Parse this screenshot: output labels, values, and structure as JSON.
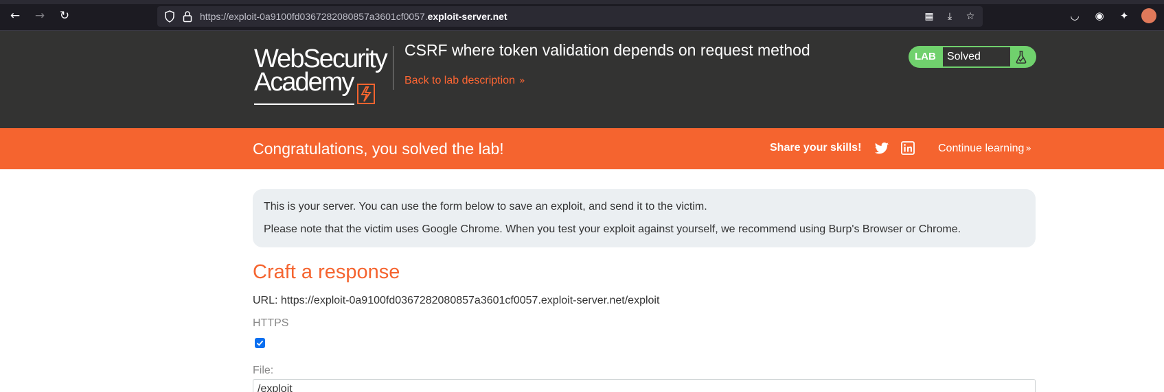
{
  "browser": {
    "url_prefix": "https://exploit-0a9100fd0367282080857a3601cf0057.",
    "url_domain": "exploit-server.net"
  },
  "header": {
    "logo_line1": "WebSecurity",
    "logo_line2": "Academy",
    "lab_title": "CSRF where token validation depends on request method",
    "back_link": "Back to lab description",
    "lab_badge": "LAB",
    "lab_status": "Solved"
  },
  "banner": {
    "congrats": "Congratulations, you solved the lab!",
    "share": "Share your skills!",
    "continue": "Continue learning"
  },
  "info": {
    "line1": "This is your server. You can use the form below to save an exploit, and send it to the victim.",
    "line2": "Please note that the victim uses Google Chrome. When you test your exploit against yourself, we recommend using Burp's Browser or Chrome."
  },
  "form": {
    "heading": "Craft a response",
    "url_text": "URL: https://exploit-0a9100fd0367282080857a3601cf0057.exploit-server.net/exploit",
    "https_label": "HTTPS",
    "https_checked": true,
    "file_label": "File:",
    "file_value": "/exploit"
  },
  "colors": {
    "accent": "#f5642f",
    "header_bg": "#333332",
    "solved_green": "#70d16d",
    "info_bg": "#ebeff2"
  }
}
